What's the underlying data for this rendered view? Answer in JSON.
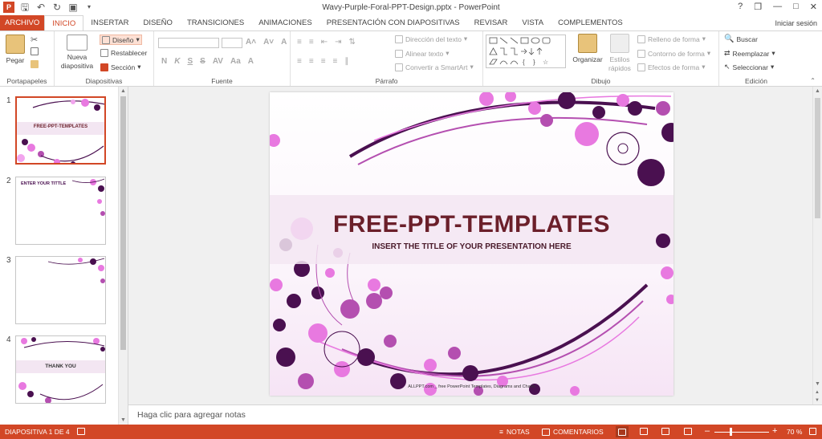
{
  "window": {
    "title": "Wavy-Purple-Foral-PPT-Design.pptx - PowerPoint",
    "help": "?",
    "restore": "❐",
    "minimize": "—",
    "maximize": "□",
    "close": "✕"
  },
  "tabs": [
    "ARCHIVO",
    "INICIO",
    "INSERTAR",
    "DISEÑO",
    "TRANSICIONES",
    "ANIMACIONES",
    "PRESENTACIÓN CON DIAPOSITIVAS",
    "REVISAR",
    "VISTA",
    "COMPLEMENTOS"
  ],
  "signin": "Iniciar sesión",
  "ribbon": {
    "clipboard": {
      "label": "Portapapeles",
      "paste": "Pegar"
    },
    "slides": {
      "label": "Diapositivas",
      "new_slide": "Nueva",
      "new_slide2": "diapositiva",
      "layout": "Diseño",
      "reset": "Restablecer",
      "section": "Sección"
    },
    "font": {
      "label": "Fuente",
      "bold": "N",
      "italic": "K",
      "underline": "S",
      "strike": "S",
      "spacing": "AV",
      "case": "Aa",
      "color": "A",
      "grow": "A˄",
      "shrink": "A˅",
      "clear": "A"
    },
    "paragraph": {
      "label": "Párrafo",
      "text_direction": "Dirección del texto",
      "align_text": "Alinear texto",
      "smartart": "Convertir a SmartArt"
    },
    "drawing": {
      "label": "Dibujo",
      "arrange": "Organizar",
      "quick_styles": "Estilos",
      "quick_styles2": "rápidos",
      "fill": "Relleno de forma",
      "outline": "Contorno de forma",
      "effects": "Efectos de forma"
    },
    "editing": {
      "label": "Edición",
      "find": "Buscar",
      "replace": "Reemplazar",
      "select": "Seleccionar"
    }
  },
  "thumbnails": [
    {
      "num": "1",
      "title": "FREE-PPT-TEMPLATES"
    },
    {
      "num": "2",
      "title": "ENTER YOUR TITTLE"
    },
    {
      "num": "3",
      "title": ""
    },
    {
      "num": "4",
      "title": "THANK YOU"
    }
  ],
  "slide": {
    "title": "FREE-PPT-TEMPLATES",
    "subtitle": "INSERT THE TITLE OF YOUR PRESENTATION HERE",
    "footer": "ALLPPT.com _ free PowerPoint Templates, Diagrams and Charts",
    "title_color": "#6b1f2a"
  },
  "notes_placeholder": "Haga clic para agregar notas",
  "status": {
    "slide_info": "DIAPOSITIVA 1 DE 4",
    "notes": "NOTAS",
    "comments": "COMENTARIOS",
    "zoom": "70 %"
  },
  "colors": {
    "accent": "#d24726",
    "pink": "#e879e0",
    "purple": "#4a1050"
  }
}
